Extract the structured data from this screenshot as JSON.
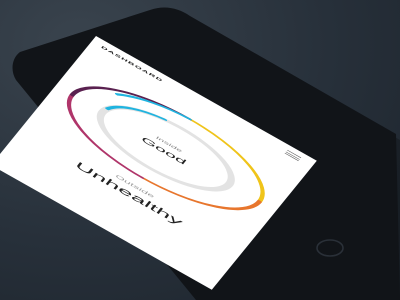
{
  "header": {
    "title": "DASHBOARD"
  },
  "menu": {
    "icon": "hamburger-menu-icon"
  },
  "inside": {
    "label": "Inside",
    "value": "Good"
  },
  "outside": {
    "label": "Outside",
    "value": "Unhealthy"
  },
  "colors": {
    "ring_start": "#1fb4e0",
    "ring_mid": "#f0c419",
    "ring_mid2": "#e8762d",
    "ring_end": "#5a2150"
  }
}
